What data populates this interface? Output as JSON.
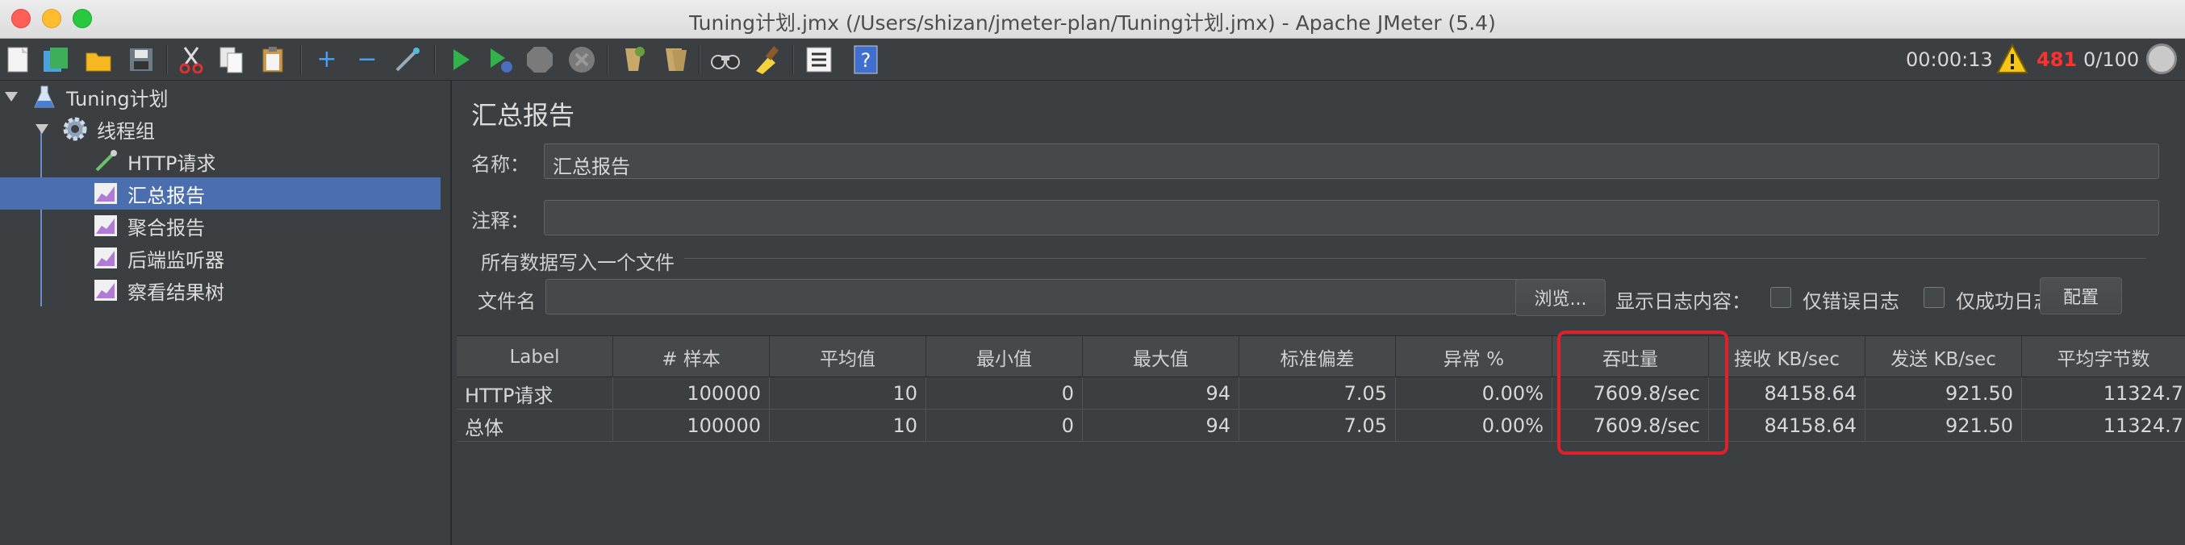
{
  "window": {
    "title": "Tuning计划.jmx (/Users/shizan/jmeter-plan/Tuning计划.jmx) - Apache JMeter (5.4)"
  },
  "toolbar": {
    "icons": [
      "new-icon",
      "templates-icon",
      "open-icon",
      "save-icon",
      "cut-icon",
      "copy-icon",
      "paste-icon",
      "expand-icon",
      "collapse-icon",
      "toggle-icon",
      "start-icon",
      "start-no-pause-icon",
      "stop-icon",
      "shutdown-icon",
      "clear-icon",
      "clear-all-icon",
      "search-icon",
      "reset-search-icon",
      "function-helper-icon",
      "help-icon"
    ],
    "elapsed_time": "00:00:13",
    "error_count": "481",
    "active_threads": "0/100",
    "colors": {
      "warning": "#f5c518",
      "error": "#ff3030"
    }
  },
  "tree": {
    "items": [
      {
        "label": "Tuning计划",
        "icon": "test-plan-icon"
      },
      {
        "label": "线程组",
        "icon": "thread-group-gear-icon"
      },
      {
        "label": "HTTP请求",
        "icon": "http-sampler-pipette-icon"
      },
      {
        "label": "汇总报告",
        "icon": "listener-chart-icon",
        "selected": true
      },
      {
        "label": "聚合报告",
        "icon": "listener-chart-icon"
      },
      {
        "label": "后端监听器",
        "icon": "listener-chart-icon"
      },
      {
        "label": "察看结果树",
        "icon": "listener-chart-icon"
      }
    ],
    "selection_color": "#4b6eaf"
  },
  "panel": {
    "title": "汇总报告",
    "name_label": "名称：",
    "name_value": "汇总报告",
    "comment_label": "注释：",
    "comment_value": "",
    "file_group_title": "所有数据写入一个文件",
    "filename_label": "文件名",
    "filename_value": "",
    "browse_button": "浏览...",
    "log_content_label": "显示日志内容：",
    "errors_only_label": "仅错误日志",
    "successes_only_label": "仅成功日志",
    "configure_button": "配置"
  },
  "table": {
    "columns": [
      "Label",
      "# 样本",
      "平均值",
      "最小值",
      "最大值",
      "标准偏差",
      "异常 %",
      "吞吐量",
      "接收 KB/sec",
      "发送 KB/sec",
      "平均字节数"
    ],
    "rows": [
      [
        "HTTP请求",
        "100000",
        "10",
        "0",
        "94",
        "7.05",
        "0.00%",
        "7609.8/sec",
        "84158.64",
        "921.50",
        "11324.7"
      ],
      [
        "总体",
        "100000",
        "10",
        "0",
        "94",
        "7.05",
        "0.00%",
        "7609.8/sec",
        "84158.64",
        "921.50",
        "11324.7"
      ]
    ],
    "highlight_color": "#e0202a"
  }
}
